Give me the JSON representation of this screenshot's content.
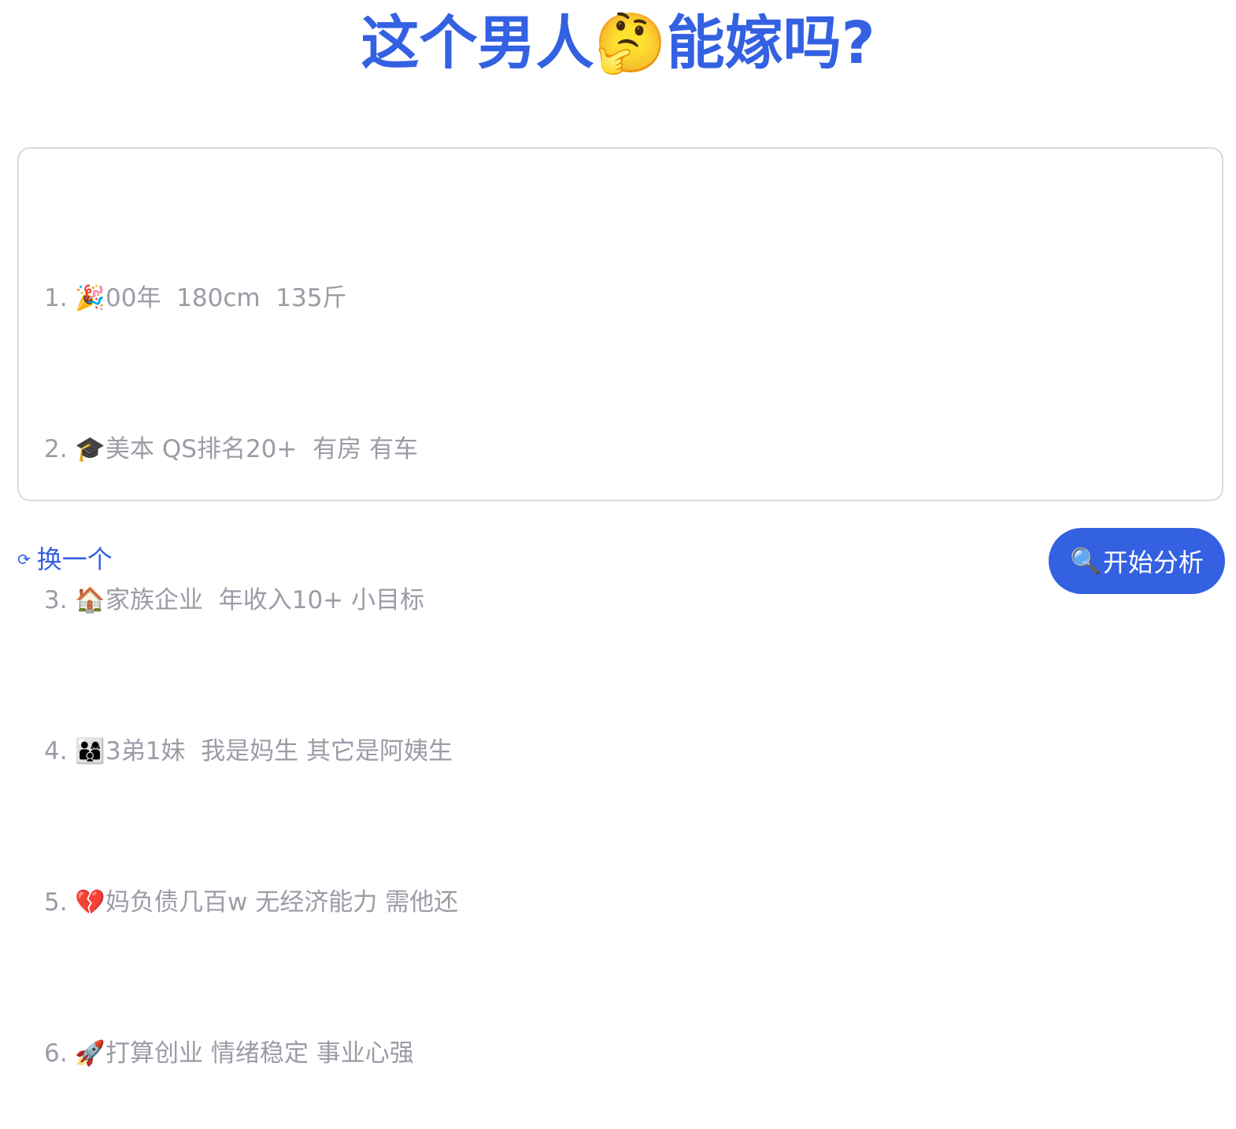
{
  "title": "这个男人🤔能嫁吗?",
  "textarea": {
    "lines": [
      "1. 🎉00年  180cm  135斤",
      "2. 🎓美本 QS排名20+  有房 有车",
      "3. 🏠家族企业  年收入10+ 小目标",
      "4. 👨‍👩‍👦3弟1妹  我是妈生 其它是阿姨生",
      "5. 💔妈负债几百w 无经济能力 需他还",
      "6. 🚀打算创业 情绪稳定 事业心强"
    ]
  },
  "refresh": {
    "icon": "⟳",
    "label": "换一个"
  },
  "analyze": {
    "icon": "🔍",
    "label": "开始分析"
  },
  "colors": {
    "accent": "#3461e2",
    "text_muted": "#9a9ca6",
    "border": "#d9d9de"
  }
}
